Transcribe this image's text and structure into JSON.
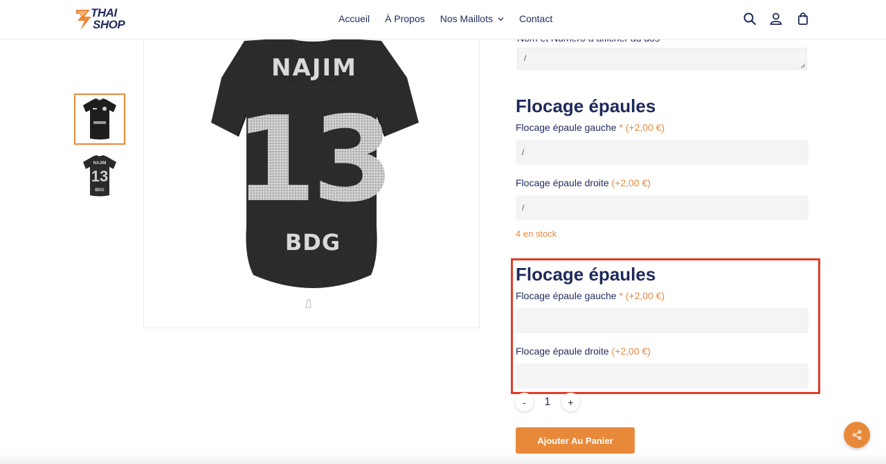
{
  "brand": {
    "line1": "THAI",
    "line2": "SHOP",
    "accent_color": "#e8893a",
    "text_color": "#1f2a5c"
  },
  "nav": {
    "items": [
      {
        "label": "Accueil"
      },
      {
        "label": "À Propos"
      },
      {
        "label": "Nos Maillots"
      },
      {
        "label": "Contact"
      }
    ]
  },
  "header_icons": [
    "search-icon",
    "account-icon",
    "bag-icon"
  ],
  "gallery": {
    "jersey_name": "NAJIM",
    "jersey_number": "13",
    "jersey_initials": "BDG",
    "thumbnails": [
      "front-view",
      "back-view"
    ]
  },
  "form": {
    "back_field": {
      "label_cut": "Nom et Numéro à afficher au dos",
      "value": "/"
    },
    "section1": {
      "title": "Flocage épaules",
      "left_label": "Flocage épaule gauche",
      "left_required": "*",
      "left_price": "(+2,00 €)",
      "left_value": "/",
      "right_label": "Flocage épaule droite",
      "right_price": "(+2,00 €)",
      "right_value": "/"
    },
    "stock": "4 en stock",
    "section2": {
      "title": "Flocage épaules",
      "left_label": "Flocage épaule gauche",
      "left_required": "*",
      "left_price": "(+2,00 €)",
      "left_value": "",
      "right_label": "Flocage épaule droite",
      "right_price": "(+2,00 €)",
      "right_value": ""
    },
    "qty_minus": "-",
    "qty_value": "1",
    "qty_plus": "+",
    "add_to_cart": "Ajouter Au Panier"
  },
  "share_icon": "share-icon",
  "highlight_color": "#e03b24"
}
